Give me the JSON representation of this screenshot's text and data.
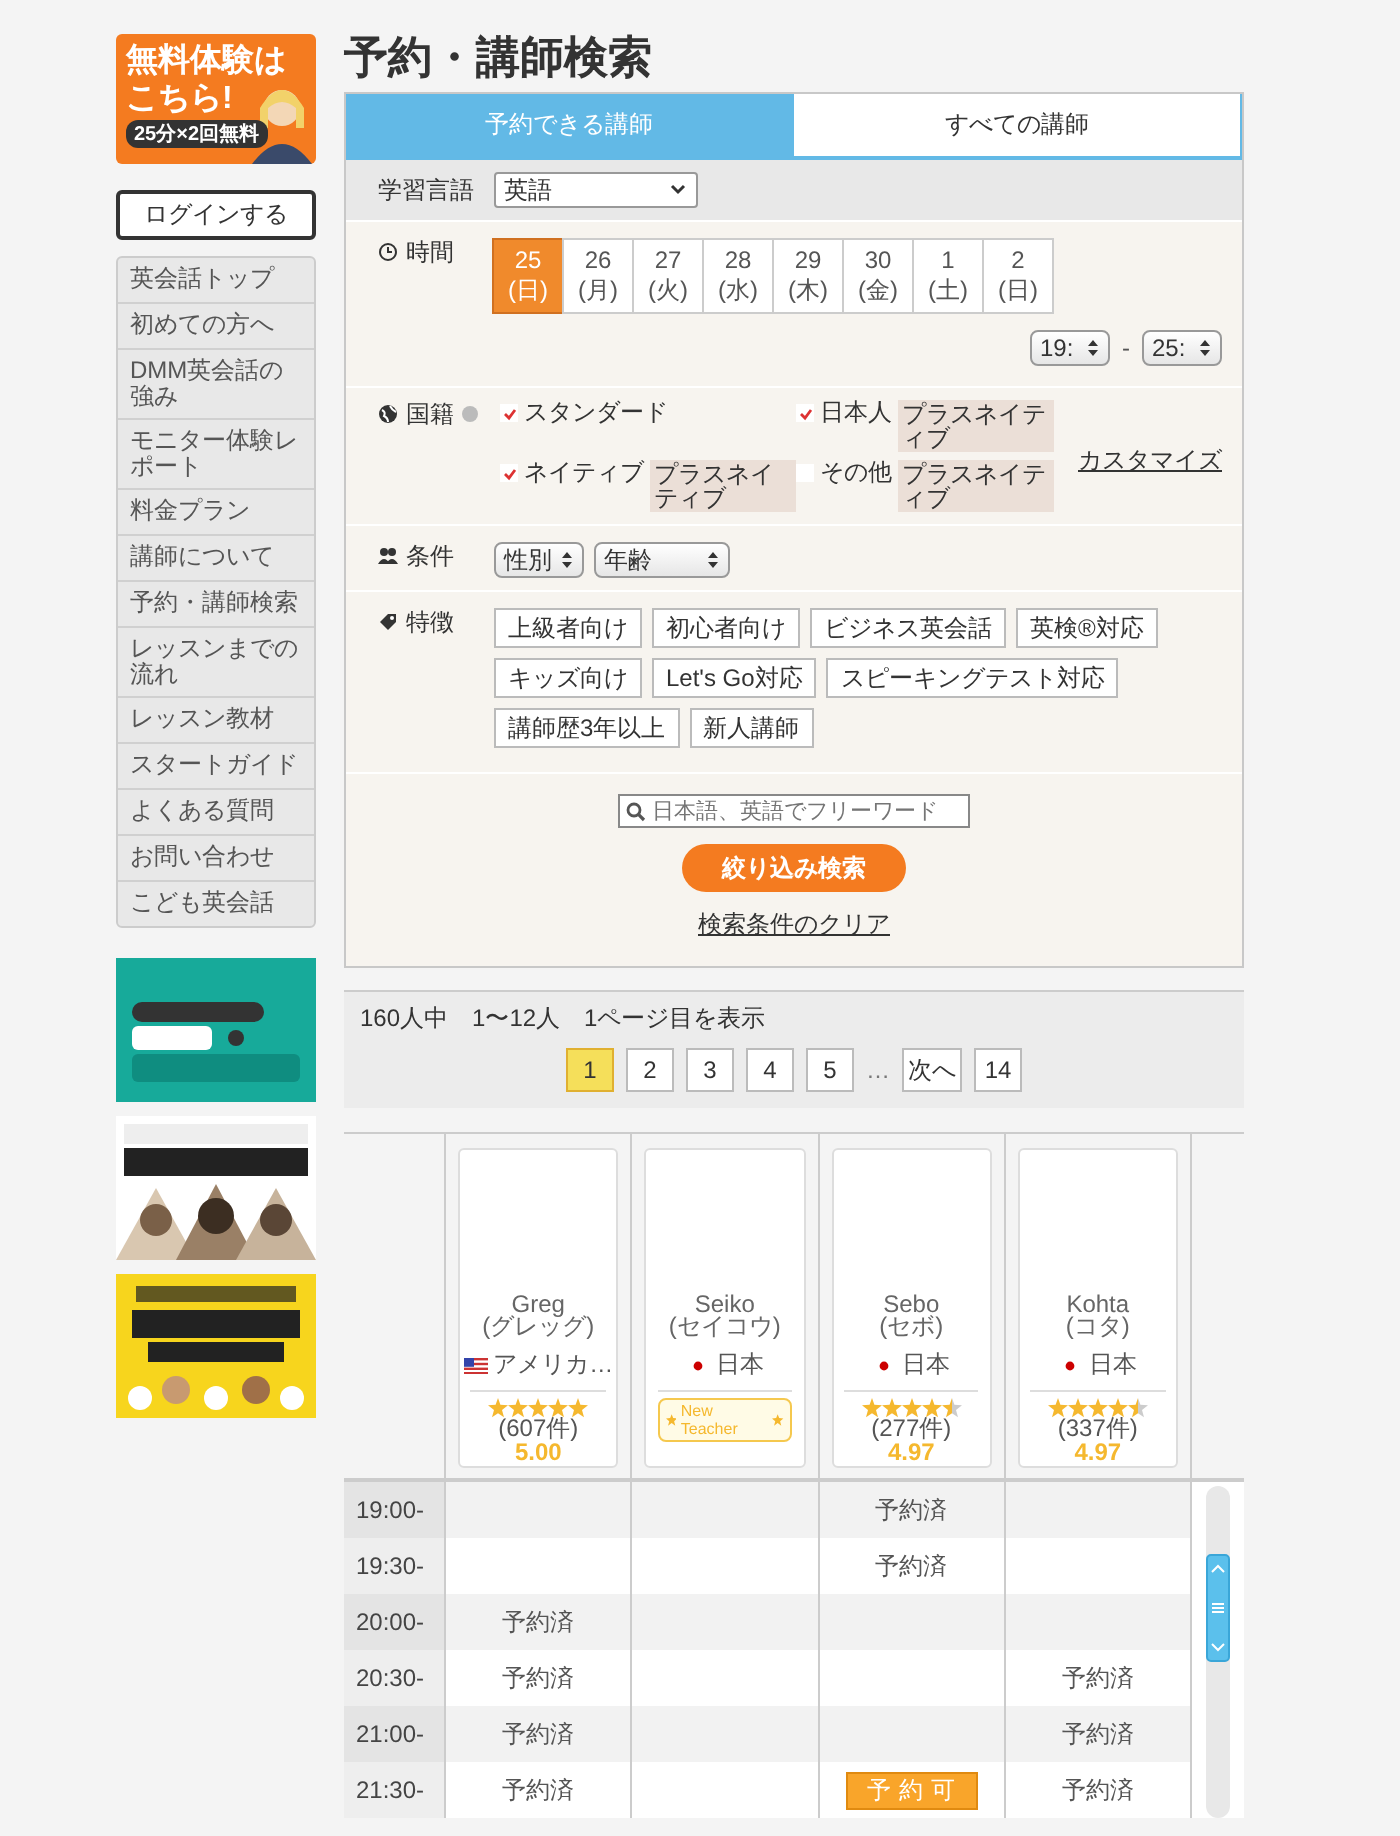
{
  "sidebar": {
    "banner": {
      "title": "無料体験はこちら!",
      "note": "25分×2回無料"
    },
    "login_button": "ログインする",
    "nav_items": [
      {
        "label": "英会話トップ"
      },
      {
        "label": "初めての方へ"
      },
      {
        "label": "DMM英会話の強み"
      },
      {
        "label": "モニター体験レポート"
      },
      {
        "label": "料金プラン"
      },
      {
        "label": "講師について"
      },
      {
        "label": "予約・講師検索"
      },
      {
        "label": "レッスンまでの流れ"
      },
      {
        "label": "レッスン教材"
      },
      {
        "label": "スタートガイド"
      },
      {
        "label": "よくある質問"
      },
      {
        "label": "お問い合わせ"
      },
      {
        "label": "こども英会話"
      }
    ]
  },
  "page_title": "予約・講師検索",
  "search": {
    "tabs": [
      {
        "label": "予約できる講師",
        "selected": true
      },
      {
        "label": "すべての講師",
        "selected": false
      }
    ],
    "language": {
      "label": "学習言語",
      "value": "英語"
    },
    "time": {
      "label": "時間",
      "dates": [
        {
          "day": "25",
          "weekday": "(日)",
          "selected": true
        },
        {
          "day": "26",
          "weekday": "(月)",
          "selected": false
        },
        {
          "day": "27",
          "weekday": "(火)",
          "selected": false
        },
        {
          "day": "28",
          "weekday": "(水)",
          "selected": false
        },
        {
          "day": "29",
          "weekday": "(木)",
          "selected": false
        },
        {
          "day": "30",
          "weekday": "(金)",
          "selected": false
        },
        {
          "day": "1",
          "weekday": "(土)",
          "selected": false
        },
        {
          "day": "2",
          "weekday": "(日)",
          "selected": false
        }
      ],
      "from": "19:",
      "separator": "-",
      "to": "25:"
    },
    "nationality": {
      "label": "国籍",
      "options": [
        {
          "label": "スタンダード",
          "checked": true
        },
        {
          "label": "日本人",
          "checked": true,
          "tag": "プラスネイティブ"
        },
        {
          "label": "ネイティブ",
          "checked": true,
          "tag": "プラスネイティブ"
        },
        {
          "label": "その他",
          "checked": false,
          "tag": "プラスネイティブ"
        }
      ],
      "customize": "カスタマイズ"
    },
    "conditions": {
      "label": "条件",
      "selects": [
        "性別",
        "年齢"
      ]
    },
    "features": {
      "label": "特徴",
      "tags": [
        "上級者向け",
        "初心者向け",
        "ビジネス英会話",
        "英検®対応",
        "キッズ向け",
        "Let's Go対応",
        "スピーキングテスト対応",
        "講師歴3年以上",
        "新人講師"
      ]
    },
    "keyword": {
      "placeholder": "日本語、英語でフリーワード"
    },
    "submit": "絞り込み検索",
    "clear": "検索条件のクリア"
  },
  "results": {
    "summary": "160人中　1〜12人　1ページ目を表示",
    "pages": [
      {
        "kind": "page",
        "label": "1",
        "selected": true
      },
      {
        "kind": "page",
        "label": "2",
        "selected": false
      },
      {
        "kind": "page",
        "label": "3",
        "selected": false
      },
      {
        "kind": "page",
        "label": "4",
        "selected": false
      },
      {
        "kind": "page",
        "label": "5",
        "selected": false
      },
      {
        "kind": "ellipsis",
        "label": "…"
      },
      {
        "kind": "page",
        "label": "次へ",
        "selected": false
      },
      {
        "kind": "page",
        "label": "14",
        "selected": false
      }
    ]
  },
  "teachers": [
    {
      "name": "Greg",
      "kana": "(グレッグ)",
      "kind": "us",
      "country": "アメリカ…",
      "stars": 5,
      "reviews": "(607件)",
      "score": "5.00"
    },
    {
      "name": "Seiko",
      "kana": "(セイコウ)",
      "kind": "jp",
      "country": "日本",
      "badge": "New Teacher"
    },
    {
      "name": "Sebo",
      "kana": "(セボ)",
      "kind": "jp",
      "country": "日本",
      "stars": 4.5,
      "reviews": "(277件)",
      "score": "4.97"
    },
    {
      "name": "Kohta",
      "kana": "(コタ)",
      "kind": "jp",
      "country": "日本",
      "stars": 4.5,
      "reviews": "(337件)",
      "score": "4.97"
    }
  ],
  "schedule": [
    {
      "time": "19:00-",
      "slots": [
        {
          "kind": "empty"
        },
        {
          "kind": "empty"
        },
        {
          "kind": "booked",
          "label": "予約済"
        },
        {
          "kind": "empty"
        }
      ]
    },
    {
      "time": "19:30-",
      "slots": [
        {
          "kind": "empty"
        },
        {
          "kind": "empty"
        },
        {
          "kind": "booked",
          "label": "予約済"
        },
        {
          "kind": "empty"
        }
      ]
    },
    {
      "time": "20:00-",
      "slots": [
        {
          "kind": "booked",
          "label": "予約済"
        },
        {
          "kind": "empty"
        },
        {
          "kind": "empty"
        },
        {
          "kind": "empty"
        }
      ]
    },
    {
      "time": "20:30-",
      "slots": [
        {
          "kind": "booked",
          "label": "予約済"
        },
        {
          "kind": "empty"
        },
        {
          "kind": "empty"
        },
        {
          "kind": "booked",
          "label": "予約済"
        }
      ]
    },
    {
      "time": "21:00-",
      "slots": [
        {
          "kind": "booked",
          "label": "予約済"
        },
        {
          "kind": "empty"
        },
        {
          "kind": "empty"
        },
        {
          "kind": "booked",
          "label": "予約済"
        }
      ]
    },
    {
      "time": "21:30-",
      "slots": [
        {
          "kind": "booked",
          "label": "予約済"
        },
        {
          "kind": "empty"
        },
        {
          "kind": "available",
          "label": "予約可"
        },
        {
          "kind": "booked",
          "label": "予約済"
        }
      ]
    }
  ]
}
